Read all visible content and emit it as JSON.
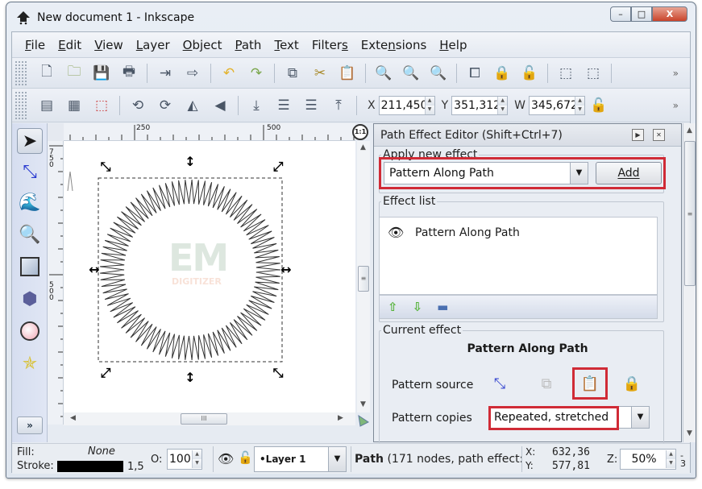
{
  "window": {
    "title": "New document 1 - Inkscape",
    "controls": {
      "minimize": "–",
      "maximize": "□",
      "close": "X"
    }
  },
  "menu": [
    {
      "label": "File",
      "accel": "F"
    },
    {
      "label": "Edit",
      "accel": "E"
    },
    {
      "label": "View",
      "accel": "V"
    },
    {
      "label": "Layer",
      "accel": "L"
    },
    {
      "label": "Object",
      "accel": "O"
    },
    {
      "label": "Path",
      "accel": "P"
    },
    {
      "label": "Text",
      "accel": "T"
    },
    {
      "label": "Filters",
      "accel": "s"
    },
    {
      "label": "Extensions",
      "accel": "n"
    },
    {
      "label": "Help",
      "accel": "H"
    }
  ],
  "commands_toolbar": {
    "icons": [
      "new-document-icon",
      "open-icon",
      "save-icon",
      "print-icon",
      "import-icon",
      "export-icon",
      "undo-icon",
      "redo-icon",
      "copy-icon",
      "cut-icon",
      "paste-icon",
      "zoom-selection-icon",
      "zoom-drawing-icon",
      "zoom-page-icon",
      "duplicate-icon",
      "clone-icon",
      "unlink-clone-icon",
      "group-icon",
      "ungroup-icon"
    ],
    "more": "»"
  },
  "tool_controls": {
    "x_label": "X",
    "x_value": "211,450",
    "y_label": "Y",
    "y_value": "351,312",
    "w_label": "W",
    "w_value": "345,672",
    "more": "»"
  },
  "rulers": {
    "h_ticks": [
      "250",
      "500"
    ],
    "v_ticks": [
      "750",
      "500"
    ],
    "zoom_1_1": "1:1"
  },
  "watermark": {
    "line1": "EM",
    "line2": "DIGITIZER"
  },
  "path_effect_editor": {
    "title": "Path Effect Editor (Shift+Ctrl+7)",
    "apply_new_effect": {
      "legend": "Apply new effect",
      "selected": "Pattern Along Path",
      "add_label": "Add"
    },
    "effect_list": {
      "legend": "Effect list",
      "items": [
        {
          "label": "Pattern Along Path",
          "visible": true
        }
      ]
    },
    "current_effect": {
      "legend": "Current effect",
      "name": "Pattern Along Path",
      "pattern_source_label": "Pattern source",
      "pattern_copies_label": "Pattern copies",
      "pattern_copies_value": "Repeated, stretched"
    }
  },
  "status": {
    "fill_label": "Fill:",
    "fill_value": "None",
    "stroke_label": "Stroke:",
    "stroke_width": "1,5",
    "opacity_label": "O:",
    "opacity_value": "100",
    "layer": "•Layer 1",
    "message_bold": "Path",
    "message": "(171 nodes, path effect:",
    "cursor_x_label": "X:",
    "cursor_x": "632,36",
    "cursor_y_label": "Y:",
    "cursor_y": "577,81",
    "zoom_label": "Z:",
    "zoom_value": "50%",
    "extra": "-3"
  },
  "colors": {
    "highlight": "#d02b36",
    "stroke_swatch": "#000000"
  }
}
